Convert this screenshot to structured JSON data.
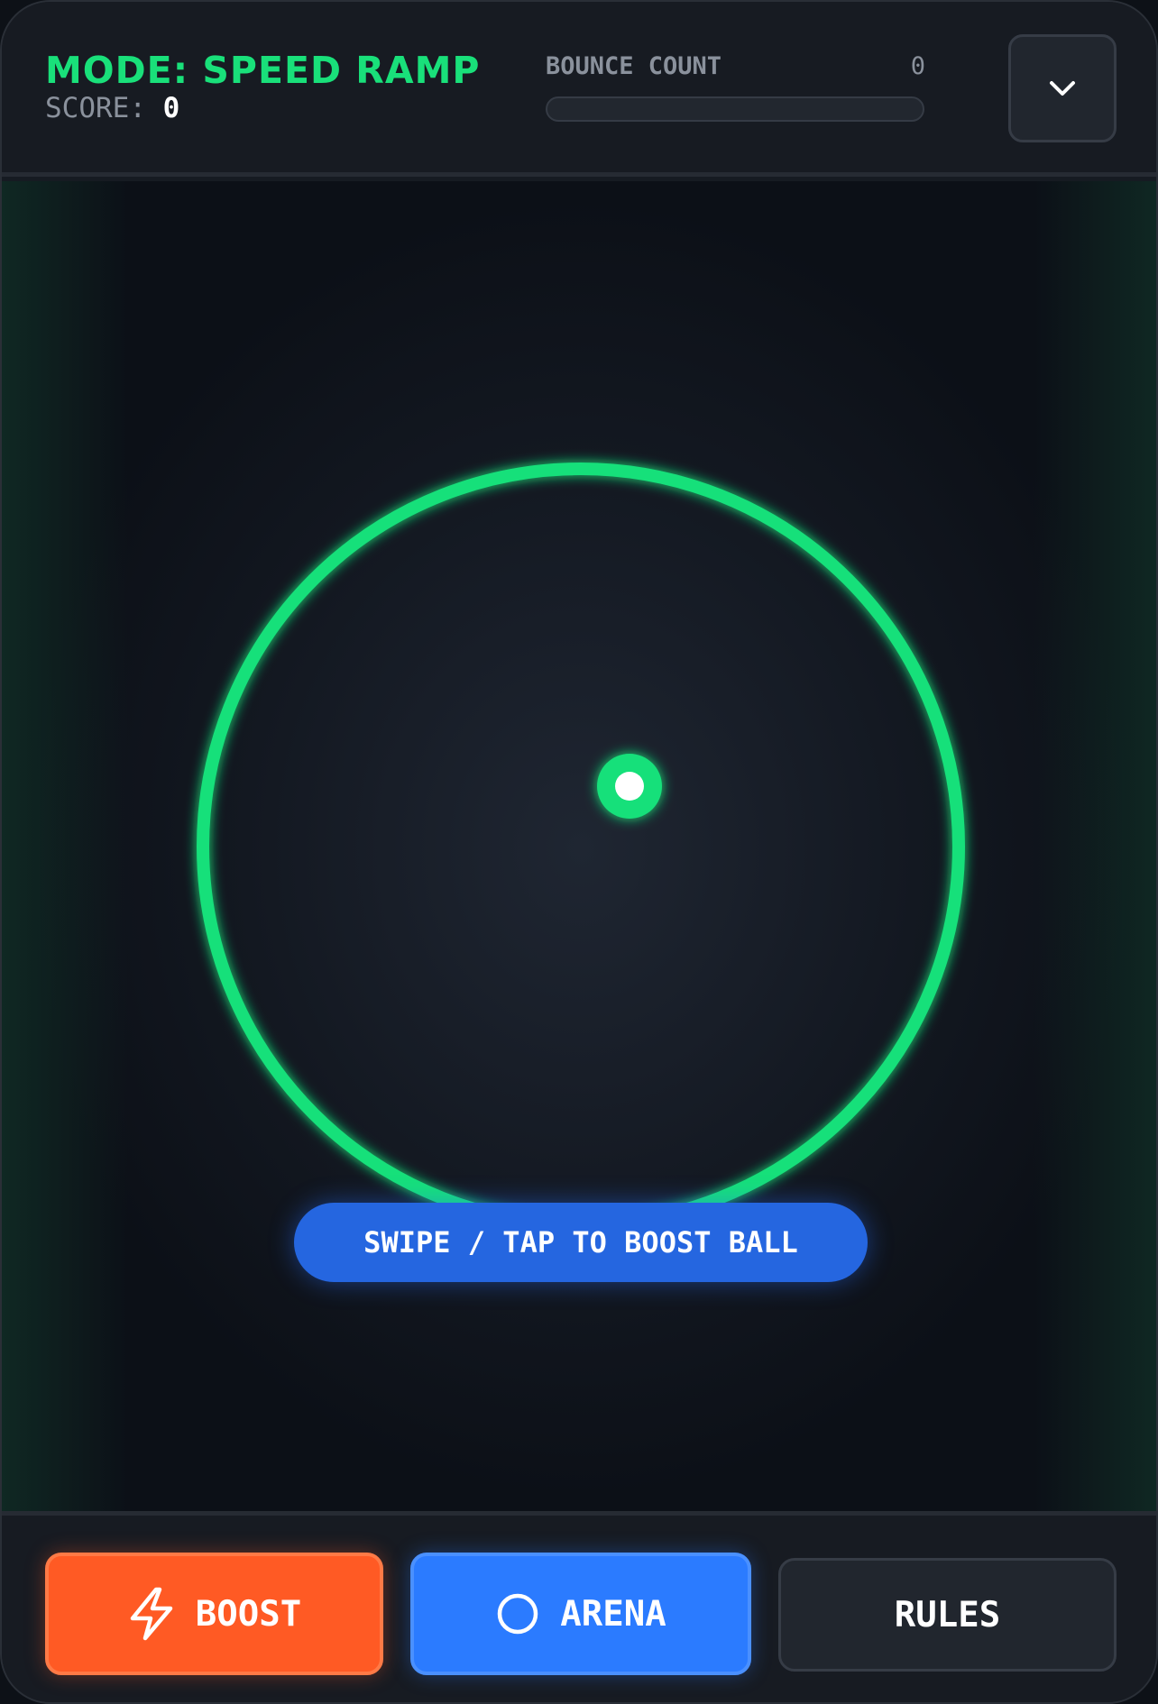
{
  "header": {
    "mode_label": "MODE: SPEED RAMP",
    "score_label": "SCORE:",
    "score_value": "0",
    "bounce_label": "BOUNCE COUNT",
    "bounce_value": "0",
    "bounce_progress": 0,
    "menu_icon": "chevron-down-icon"
  },
  "arena": {
    "ring_color": "#19e07a",
    "ball_color": "#19e07a",
    "hint_text": "SWIPE / TAP TO BOOST BALL"
  },
  "footer": {
    "boost": {
      "label": "BOOST",
      "icon": "lightning-icon",
      "color": "#ff5a24"
    },
    "arena": {
      "label": "ARENA",
      "icon": "circle-icon",
      "color": "#2b7bff"
    },
    "rules": {
      "label": "RULES"
    }
  }
}
